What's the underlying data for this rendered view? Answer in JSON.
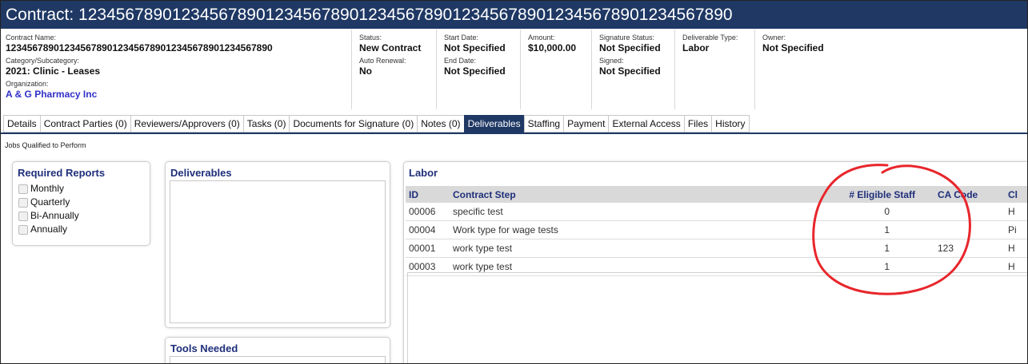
{
  "header": {
    "title": "Contract: 1234567890123456789012345678901234567890123456789012345678901234567890"
  },
  "info": {
    "contract_name_label": "Contract Name:",
    "contract_name": "12345678901234567890123456789012345678901234567890",
    "category_label": "Category/Subcategory:",
    "category": "2021: Clinic - Leases",
    "organization_label": "Organization:",
    "organization": "A & G Pharmacy Inc",
    "status_label": "Status:",
    "status": "New Contract",
    "auto_renewal_label": "Auto Renewal:",
    "auto_renewal": "No",
    "start_date_label": "Start Date:",
    "start_date": "Not Specified",
    "end_date_label": "End Date:",
    "end_date": "Not Specified",
    "amount_label": "Amount:",
    "amount": "$10,000.00",
    "signature_status_label": "Signature Status:",
    "signature_status": "Not Specified",
    "signed_label": "Signed:",
    "signed": "Not Specified",
    "deliverable_type_label": "Deliverable Type:",
    "deliverable_type": "Labor",
    "owner_label": "Owner:",
    "owner": "Not Specified"
  },
  "tabs": [
    {
      "label": "Details"
    },
    {
      "label": "Contract Parties (0)"
    },
    {
      "label": "Reviewers/Approvers (0)"
    },
    {
      "label": "Tasks (0)"
    },
    {
      "label": "Documents for Signature (0)"
    },
    {
      "label": "Notes (0)"
    },
    {
      "label": "Deliverables"
    },
    {
      "label": "Staffing"
    },
    {
      "label": "Payment"
    },
    {
      "label": "External Access"
    },
    {
      "label": "Files"
    },
    {
      "label": "History"
    }
  ],
  "active_tab": "Deliverables",
  "subtitle": "Jobs Qualified to Perform",
  "required_reports": {
    "title": "Required Reports",
    "options": [
      {
        "label": "Monthly"
      },
      {
        "label": "Quarterly"
      },
      {
        "label": "Bi-Annually"
      },
      {
        "label": "Annually"
      }
    ]
  },
  "deliverables": {
    "title": "Deliverables"
  },
  "tools": {
    "title": "Tools Needed"
  },
  "labor": {
    "title": "Labor",
    "columns": {
      "id": "ID",
      "step": "Contract Step",
      "staff": "# Eligible Staff",
      "ca": "CA Code",
      "cl": "Cl"
    },
    "rows": [
      {
        "id": "00006",
        "step": "specific test",
        "staff": "0",
        "ca": "",
        "cl": "H"
      },
      {
        "id": "00004",
        "step": "Work type for wage tests",
        "staff": "1",
        "ca": "",
        "cl": "Pi"
      },
      {
        "id": "00001",
        "step": "work type test",
        "staff": "1",
        "ca": "123",
        "cl": "H"
      },
      {
        "id": "00003",
        "step": "work type test",
        "staff": "1",
        "ca": "",
        "cl": "H"
      }
    ]
  },
  "colors": {
    "primary": "#1f3864",
    "annotation": "#e8262b",
    "link": "#3030c8"
  }
}
